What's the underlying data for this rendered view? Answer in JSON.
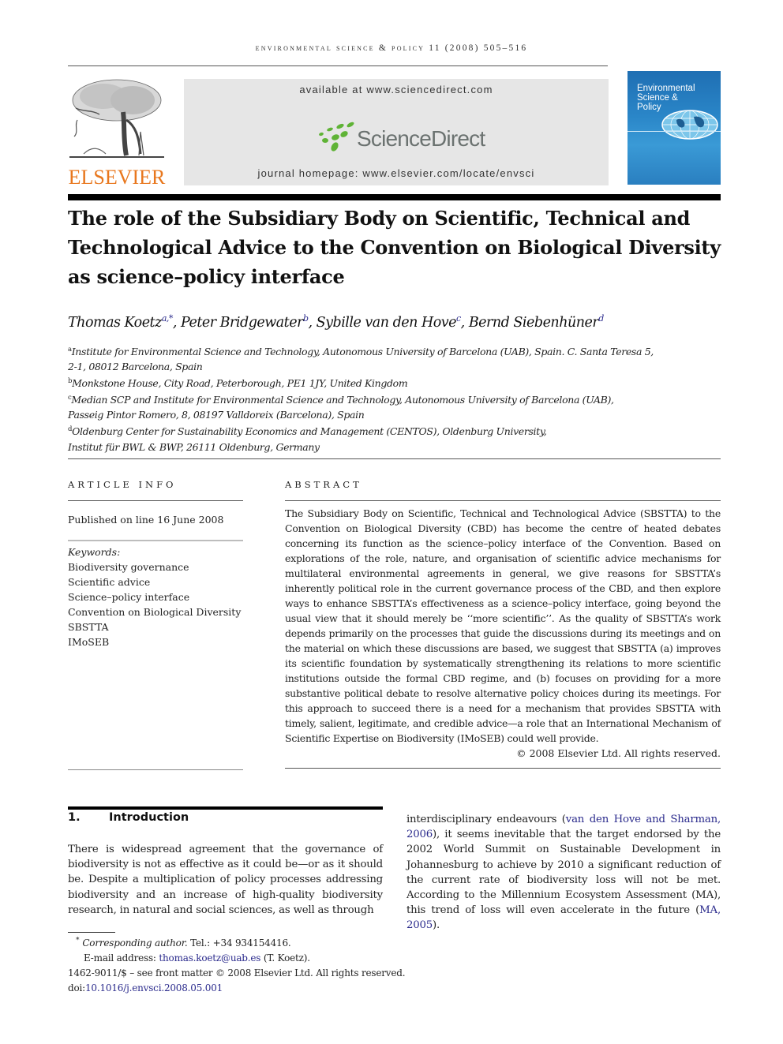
{
  "header": {
    "running_head": "Environmental Science & Policy 11 (2008) 505–516",
    "publisher_logo_text": "ELSEVIER",
    "available_at": "available at www.sciencedirect.com",
    "sciencedirect_logo_text": "ScienceDirect",
    "journal_homepage": "journal homepage: www.elsevier.com/locate/envsci",
    "cover": {
      "title_line1": "Environmental",
      "title_line2": "Science &",
      "title_line3": "Policy"
    },
    "colors": {
      "elsevier_orange": "#e8771d",
      "sciencedirect_green": "#5fb336",
      "link_blue": "#2a2a8c",
      "cover_blue": "#2a86c8"
    }
  },
  "article": {
    "title": "The role of the Subsidiary Body on Scientific, Technical and Technological Advice to the Convention on Biological Diversity as science–policy interface",
    "authors": [
      {
        "name": "Thomas Koetz",
        "sup": "a,*"
      },
      {
        "name": "Peter Bridgewater",
        "sup": "b"
      },
      {
        "name": "Sybille van den Hove",
        "sup": "c"
      },
      {
        "name": "Bernd Siebenhüner",
        "sup": "d"
      }
    ],
    "author_separator": ", ",
    "affiliations": [
      {
        "sup": "a",
        "line1": "Institute for Environmental Science and Technology, Autonomous University of Barcelona (UAB), Spain. C. Santa Teresa 5,",
        "line2": "2-1, 08012 Barcelona, Spain"
      },
      {
        "sup": "b",
        "line1": "Monkstone House, City Road, Peterborough, PE1 1JY, United Kingdom",
        "line2": ""
      },
      {
        "sup": "c",
        "line1": "Median SCP and Institute for Environmental Science and Technology, Autonomous University of Barcelona (UAB),",
        "line2": "Passeig Pintor Romero, 8, 08197 Valldoreix (Barcelona), Spain"
      },
      {
        "sup": "d",
        "line1": "Oldenburg Center for Sustainability Economics and Management (CENTOS), Oldenburg University,",
        "line2": "Institut für BWL & BWP, 26111 Oldenburg, Germany"
      }
    ]
  },
  "article_info": {
    "heading": "ARTICLE INFO",
    "published": "Published on line 16 June 2008",
    "keywords_label": "Keywords:",
    "keywords": [
      "Biodiversity governance",
      "Scientific advice",
      "Science–policy interface",
      "Convention on Biological Diversity",
      "SBSTTA",
      "IMoSEB"
    ]
  },
  "abstract": {
    "heading": "ABSTRACT",
    "text": "The Subsidiary Body on Scientific, Technical and Technological Advice (SBSTTA) to the Convention on Biological Diversity (CBD) has become the centre of heated debates concerning its function as the science–policy interface of the Convention. Based on explorations of the role, nature, and organisation of scientific advice mechanisms for multilateral environmental agreements in general, we give reasons for SBSTTA’s inherently political role in the current governance process of the CBD, and then explore ways to enhance SBSTTA’s effectiveness as a science–policy interface, going beyond the usual view that it should merely be ‘‘more scientific’’. As the quality of SBSTTA’s work depends primarily on the processes that guide the discussions during its meetings and on the material on which these discussions are based, we suggest that SBSTTA (a) improves its scientific foundation by systematically strengthening its relations to more scientific institutions outside the formal CBD regime, and (b) focuses on providing for a more substantive political debate to resolve alternative policy choices during its meetings. For this approach to succeed there is a need for a mechanism that provides SBSTTA with timely, salient, legitimate, and credible advice—a role that an International Mechanism of Scientific Expertise on Biodiversity (IMoSEB) could well provide.",
    "copyright": "© 2008 Elsevier Ltd. All rights reserved."
  },
  "introduction": {
    "number": "1.",
    "heading": "Introduction",
    "col1_text": "There is widespread agreement that the governance of biodiversity is not as effective as it could be—or as it should be. Despite a multiplication of policy processes addressing biodiversity and an increase of high-quality biodiversity research, in natural and social sciences, as well as through",
    "col2_before": "interdisciplinary endeavours (",
    "col2_cite1": "van den Hove and Sharman, 2006",
    "col2_middle": "), it seems inevitable that the target endorsed by the 2002 World Summit on Sustainable Development in Johannesburg to achieve by 2010 a significant reduction of the current rate of biodiversity loss will not be met. According to the Millennium Ecosystem Assessment (MA), this trend of loss will even accelerate in the future (",
    "col2_cite2": "MA, 2005",
    "col2_after": ")."
  },
  "footnotes": {
    "corresponding_mark": "*",
    "corresponding_label": "Corresponding author.",
    "tel": " Tel.: +34 934154416.",
    "email_label": "E-mail address: ",
    "email": "thomas.koetz@uab.es",
    "email_suffix": " (T. Koetz).",
    "front_matter": "1462-9011/$ – see front matter © 2008 Elsevier Ltd. All rights reserved.",
    "doi_label": "doi:",
    "doi": "10.1016/j.envsci.2008.05.001"
  }
}
